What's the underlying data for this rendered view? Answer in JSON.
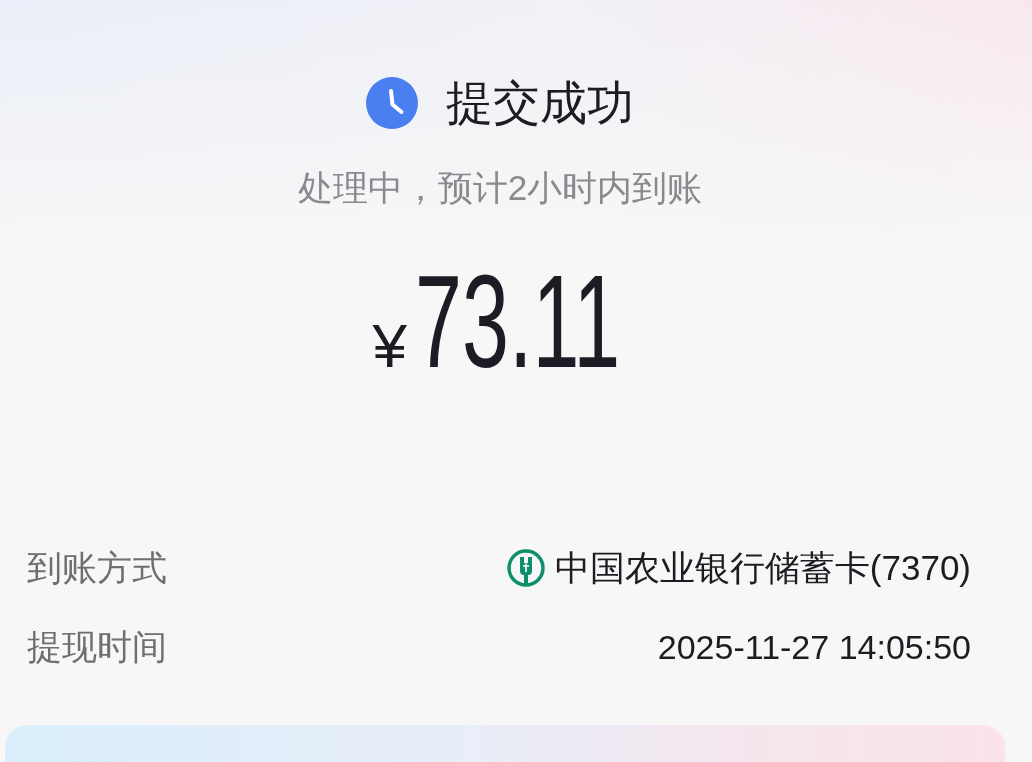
{
  "header": {
    "title": "提交成功",
    "subtitle": "处理中，预计2小时内到账"
  },
  "amount": {
    "currency": "¥",
    "value": "73.11"
  },
  "details": [
    {
      "kind": "bank",
      "label": "到账方式",
      "value": "中国农业银行储蓄卡(7370)"
    },
    {
      "kind": "text",
      "label": "提现时间",
      "value": "2025-11-27 14:05:50"
    }
  ]
}
